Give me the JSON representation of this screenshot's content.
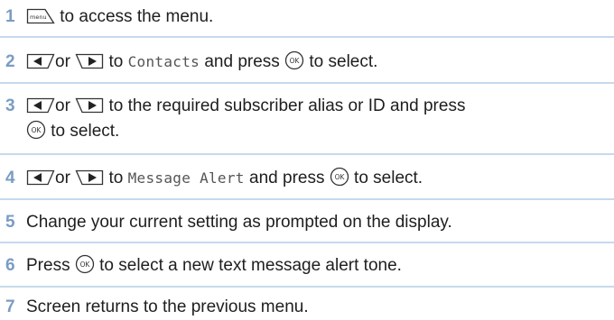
{
  "steps": [
    {
      "num": "1",
      "menu_key_label": "menu",
      "text": "to access the menu."
    },
    {
      "num": "2",
      "connector": "or",
      "text_a": "to",
      "target": "Contacts",
      "text_b": "and press",
      "text_c": "to select."
    },
    {
      "num": "3",
      "connector": "or",
      "text_a": "to the required subscriber alias or ID and press",
      "text_c": "to select."
    },
    {
      "num": "4",
      "connector": "or",
      "text_a": "to",
      "target": "Message Alert",
      "text_b": "and press",
      "text_c": "to select."
    },
    {
      "num": "5",
      "text": "Change your current setting as prompted on the display."
    },
    {
      "num": "6",
      "text_a": "Press",
      "text_c": "to select a new text message alert tone."
    },
    {
      "num": "7",
      "text": "Screen returns to the previous menu."
    }
  ],
  "ok_key_label": "OK",
  "colors": {
    "step_number": "#7a9cc4",
    "divider": "#c6d9ee",
    "key_outline": "#333333"
  },
  "icons": [
    "menu-key-icon",
    "left-arrow-key-icon",
    "right-arrow-key-icon",
    "ok-key-icon"
  ]
}
